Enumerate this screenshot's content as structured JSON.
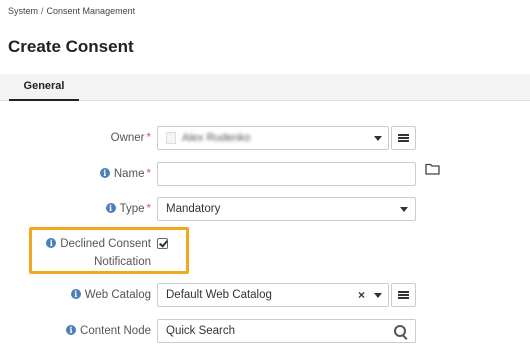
{
  "breadcrumb": {
    "items": [
      "System",
      "Consent Management"
    ],
    "separator": "/"
  },
  "page": {
    "title": "Create Consent"
  },
  "tabs": [
    {
      "label": "General",
      "active": true
    }
  ],
  "form": {
    "required_marker": "*",
    "info_glyph": "i",
    "owner": {
      "label": "Owner",
      "value": "Alex Rudenko",
      "required": true
    },
    "name": {
      "label": "Name",
      "value": "",
      "required": true
    },
    "type": {
      "label": "Type",
      "value": "Mandatory",
      "required": true
    },
    "declined_notification": {
      "label_line1": "Declined Consent",
      "label_line2": "Notification",
      "checked": true
    },
    "web_catalog": {
      "label": "Web Catalog",
      "value": "Default Web Catalog",
      "clear_glyph": "×"
    },
    "content_node": {
      "label": "Content Node",
      "placeholder": "Quick Search"
    }
  },
  "colors": {
    "highlight": "#f0a81c",
    "required": "#d9534f",
    "info": "#4a7fb8",
    "tab_bar": "#f3f3f3"
  }
}
